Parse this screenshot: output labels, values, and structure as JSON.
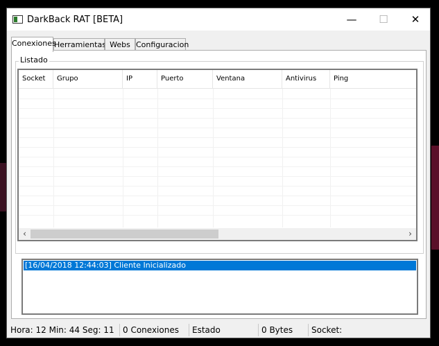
{
  "window": {
    "title": "DarkBack RAT [BETA]",
    "minimize": "—",
    "maximize": "☐",
    "close": "✕"
  },
  "tabs": [
    {
      "label": "Conexiones",
      "active": true
    },
    {
      "label": "Herramientas",
      "active": false
    },
    {
      "label": "Webs",
      "active": false
    },
    {
      "label": "Configuracion",
      "active": false
    }
  ],
  "listado": {
    "group_label": "Listado",
    "columns": [
      "Socket",
      "Grupo",
      "IP",
      "Puerto",
      "Ventana",
      "Antivirus",
      "Ping"
    ],
    "rows": []
  },
  "scroll": {
    "left_arrow": "‹",
    "right_arrow": "›"
  },
  "log": {
    "lines": [
      "[16/04/2018 12:44:03] Cliente Inicializado"
    ],
    "selected_color": "#0078d7"
  },
  "statusbar": {
    "time": "Hora: 12 Min: 44 Seg: 11",
    "connections": "0 Conexiones",
    "estado": "Estado",
    "bytes": "0 Bytes",
    "socket": "Socket:"
  }
}
